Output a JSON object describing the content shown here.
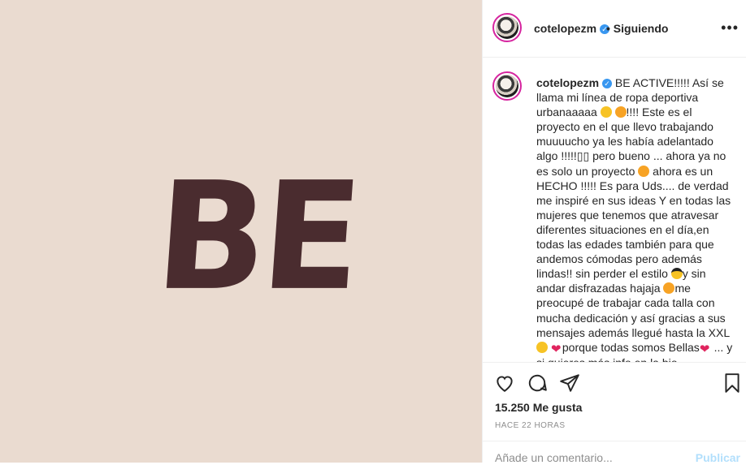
{
  "post_image": {
    "logo_text": "BE"
  },
  "header": {
    "username": "cotelopezm",
    "follow_status": "• Siguiendo",
    "more_icon": "more-options-icon"
  },
  "caption": {
    "username": "cotelopezm",
    "part1": "BE ACTIVE!!!!! Así se llama mi línea de ropa deportiva urbanaaaaa ",
    "part2": "!!!! Este es el proyecto en el que llevo trabajando muuuucho ya les había adelantado algo !!!!!▯▯ pero bueno ... ahora ya no es solo un proyecto ",
    "part3": " ahora es un HECHO !!!!! Es para Uds.... de verdad me inspiré en sus ideas Y en todas las mujeres que tenemos que atravesar diferentes situaciones en el día,en todas las edades también para que andemos cómodas pero además lindas!! sin perder el estilo ",
    "part4": "y sin andar disfrazadas hajaja ",
    "part5": "me preocupé de trabajar cada talla con mucha dedicación y así gracias a sus mensajes además llegué hasta la XXL ",
    "part6": "porque todas somos Bellas",
    "part7": " ... y si quieres más info en la bio"
  },
  "actions": {
    "likes": "15.250 Me gusta",
    "timestamp": "HACE 22 HORAS"
  },
  "comment": {
    "placeholder": "Añade un comentario...",
    "publish_label": "Publicar"
  }
}
